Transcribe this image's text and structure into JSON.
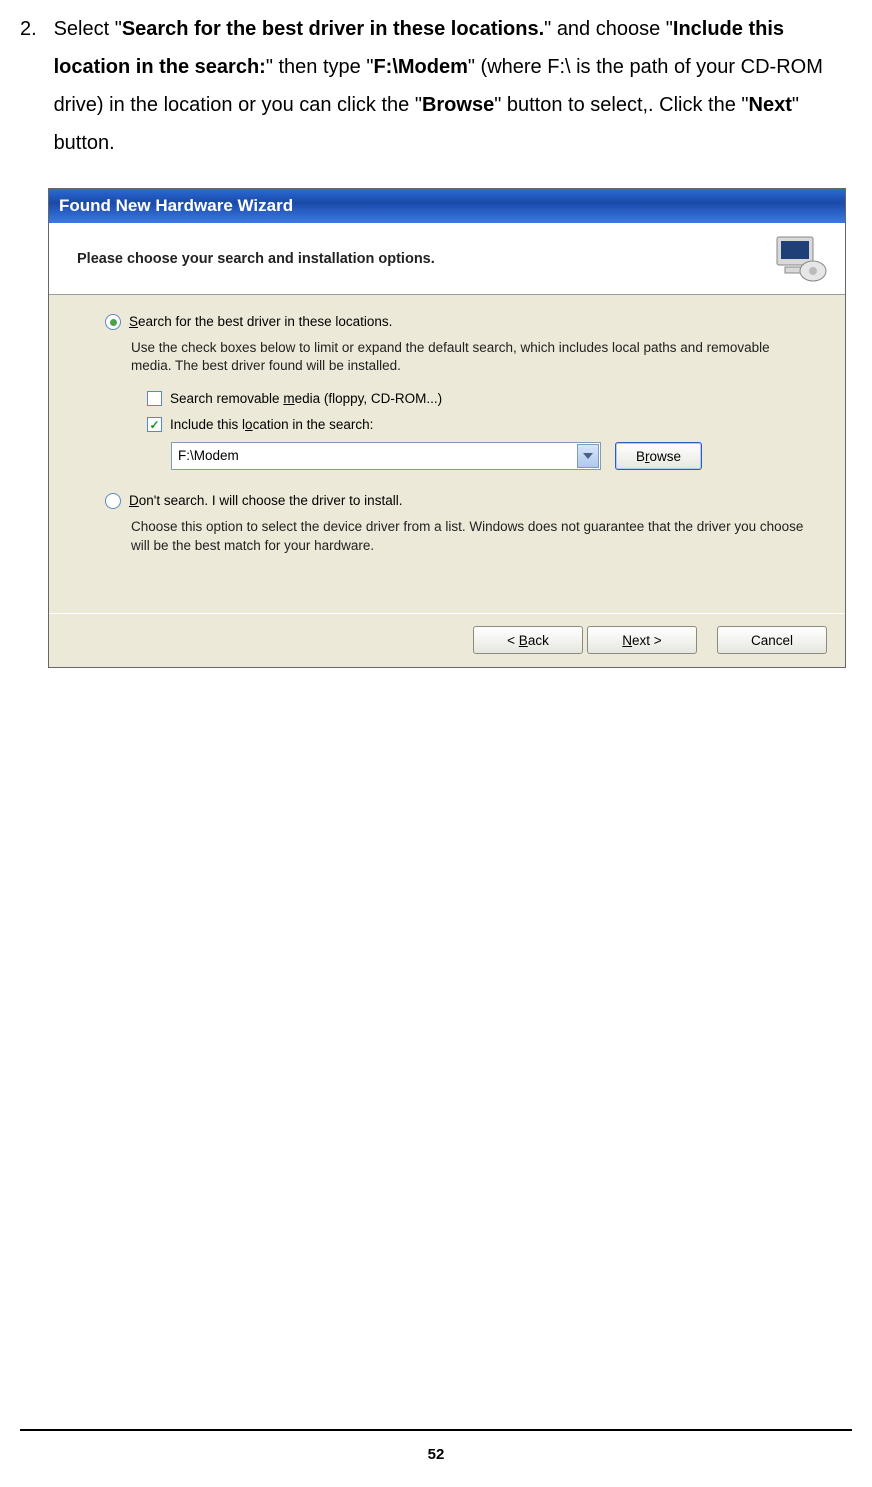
{
  "instruction": {
    "number": "2.",
    "text_parts": {
      "p1": "Select \"",
      "b1": "Search for the best driver in these locations.",
      "p2": "\" and choose \"",
      "b2": "Include this location in the search:",
      "p3": "\" then type \"",
      "b3": "F:\\Modem",
      "p4": "\" (where F:\\ is the path of your CD-ROM drive) in the location or you can click the \"",
      "b4": "Browse",
      "p5": "\" button to select,. Click the \"",
      "b5": "Next",
      "p6": "\" button."
    }
  },
  "window": {
    "title": "Found New Hardware Wizard",
    "header": "Please choose your search and installation options."
  },
  "options": {
    "radio1_label_pre": "S",
    "radio1_label_rest": "earch for the best driver in these locations.",
    "radio1_help": "Use the check boxes below to limit or expand the default search, which includes local paths and removable media. The best driver found will be installed.",
    "check1_label_pre": "Search removable ",
    "check1_label_u": "m",
    "check1_label_rest": "edia (floppy, CD-ROM...)",
    "check2_label_pre": "Include this l",
    "check2_label_u": "o",
    "check2_label_rest": "cation in the search:",
    "path_value": "F:\\Modem",
    "browse_pre": "B",
    "browse_u": "r",
    "browse_rest": "owse",
    "radio2_label_u": "D",
    "radio2_label_rest": "on't search. I will choose the driver to install.",
    "radio2_help": "Choose this option to select the device driver from a list.  Windows does not guarantee that the driver you choose will be the best match for your hardware."
  },
  "buttons": {
    "back_pre": "< ",
    "back_u": "B",
    "back_rest": "ack",
    "next_u": "N",
    "next_rest": "ext >",
    "cancel": "Cancel"
  },
  "page_number": "52"
}
